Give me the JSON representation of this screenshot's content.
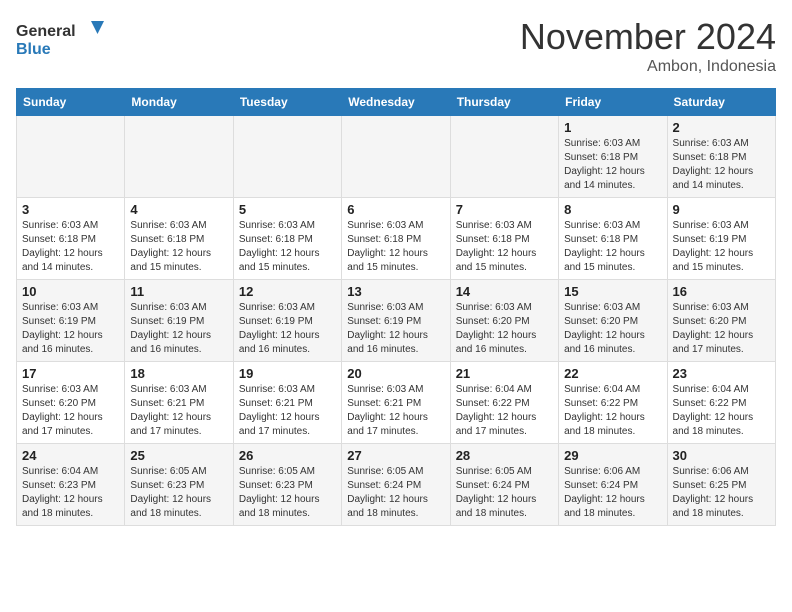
{
  "header": {
    "logo_line1": "General",
    "logo_line2": "Blue",
    "month": "November 2024",
    "location": "Ambon, Indonesia"
  },
  "days_of_week": [
    "Sunday",
    "Monday",
    "Tuesday",
    "Wednesday",
    "Thursday",
    "Friday",
    "Saturday"
  ],
  "weeks": [
    [
      {
        "day": "",
        "info": ""
      },
      {
        "day": "",
        "info": ""
      },
      {
        "day": "",
        "info": ""
      },
      {
        "day": "",
        "info": ""
      },
      {
        "day": "",
        "info": ""
      },
      {
        "day": "1",
        "info": "Sunrise: 6:03 AM\nSunset: 6:18 PM\nDaylight: 12 hours and 14 minutes."
      },
      {
        "day": "2",
        "info": "Sunrise: 6:03 AM\nSunset: 6:18 PM\nDaylight: 12 hours and 14 minutes."
      }
    ],
    [
      {
        "day": "3",
        "info": "Sunrise: 6:03 AM\nSunset: 6:18 PM\nDaylight: 12 hours and 14 minutes."
      },
      {
        "day": "4",
        "info": "Sunrise: 6:03 AM\nSunset: 6:18 PM\nDaylight: 12 hours and 15 minutes."
      },
      {
        "day": "5",
        "info": "Sunrise: 6:03 AM\nSunset: 6:18 PM\nDaylight: 12 hours and 15 minutes."
      },
      {
        "day": "6",
        "info": "Sunrise: 6:03 AM\nSunset: 6:18 PM\nDaylight: 12 hours and 15 minutes."
      },
      {
        "day": "7",
        "info": "Sunrise: 6:03 AM\nSunset: 6:18 PM\nDaylight: 12 hours and 15 minutes."
      },
      {
        "day": "8",
        "info": "Sunrise: 6:03 AM\nSunset: 6:18 PM\nDaylight: 12 hours and 15 minutes."
      },
      {
        "day": "9",
        "info": "Sunrise: 6:03 AM\nSunset: 6:19 PM\nDaylight: 12 hours and 15 minutes."
      }
    ],
    [
      {
        "day": "10",
        "info": "Sunrise: 6:03 AM\nSunset: 6:19 PM\nDaylight: 12 hours and 16 minutes."
      },
      {
        "day": "11",
        "info": "Sunrise: 6:03 AM\nSunset: 6:19 PM\nDaylight: 12 hours and 16 minutes."
      },
      {
        "day": "12",
        "info": "Sunrise: 6:03 AM\nSunset: 6:19 PM\nDaylight: 12 hours and 16 minutes."
      },
      {
        "day": "13",
        "info": "Sunrise: 6:03 AM\nSunset: 6:19 PM\nDaylight: 12 hours and 16 minutes."
      },
      {
        "day": "14",
        "info": "Sunrise: 6:03 AM\nSunset: 6:20 PM\nDaylight: 12 hours and 16 minutes."
      },
      {
        "day": "15",
        "info": "Sunrise: 6:03 AM\nSunset: 6:20 PM\nDaylight: 12 hours and 16 minutes."
      },
      {
        "day": "16",
        "info": "Sunrise: 6:03 AM\nSunset: 6:20 PM\nDaylight: 12 hours and 17 minutes."
      }
    ],
    [
      {
        "day": "17",
        "info": "Sunrise: 6:03 AM\nSunset: 6:20 PM\nDaylight: 12 hours and 17 minutes."
      },
      {
        "day": "18",
        "info": "Sunrise: 6:03 AM\nSunset: 6:21 PM\nDaylight: 12 hours and 17 minutes."
      },
      {
        "day": "19",
        "info": "Sunrise: 6:03 AM\nSunset: 6:21 PM\nDaylight: 12 hours and 17 minutes."
      },
      {
        "day": "20",
        "info": "Sunrise: 6:03 AM\nSunset: 6:21 PM\nDaylight: 12 hours and 17 minutes."
      },
      {
        "day": "21",
        "info": "Sunrise: 6:04 AM\nSunset: 6:22 PM\nDaylight: 12 hours and 17 minutes."
      },
      {
        "day": "22",
        "info": "Sunrise: 6:04 AM\nSunset: 6:22 PM\nDaylight: 12 hours and 18 minutes."
      },
      {
        "day": "23",
        "info": "Sunrise: 6:04 AM\nSunset: 6:22 PM\nDaylight: 12 hours and 18 minutes."
      }
    ],
    [
      {
        "day": "24",
        "info": "Sunrise: 6:04 AM\nSunset: 6:23 PM\nDaylight: 12 hours and 18 minutes."
      },
      {
        "day": "25",
        "info": "Sunrise: 6:05 AM\nSunset: 6:23 PM\nDaylight: 12 hours and 18 minutes."
      },
      {
        "day": "26",
        "info": "Sunrise: 6:05 AM\nSunset: 6:23 PM\nDaylight: 12 hours and 18 minutes."
      },
      {
        "day": "27",
        "info": "Sunrise: 6:05 AM\nSunset: 6:24 PM\nDaylight: 12 hours and 18 minutes."
      },
      {
        "day": "28",
        "info": "Sunrise: 6:05 AM\nSunset: 6:24 PM\nDaylight: 12 hours and 18 minutes."
      },
      {
        "day": "29",
        "info": "Sunrise: 6:06 AM\nSunset: 6:24 PM\nDaylight: 12 hours and 18 minutes."
      },
      {
        "day": "30",
        "info": "Sunrise: 6:06 AM\nSunset: 6:25 PM\nDaylight: 12 hours and 18 minutes."
      }
    ]
  ]
}
